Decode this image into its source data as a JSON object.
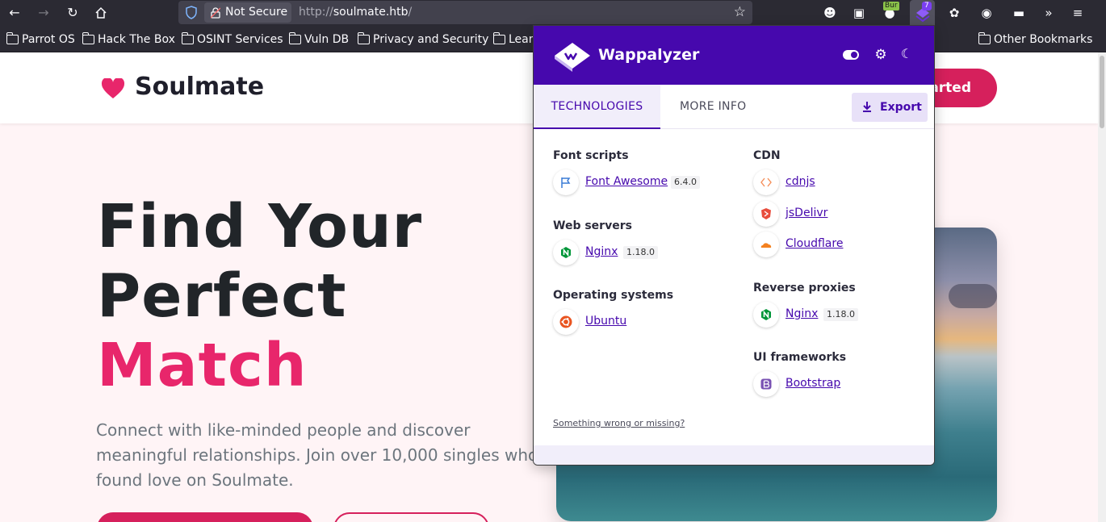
{
  "browser": {
    "security_label": "Not Secure",
    "url_scheme": "http://",
    "url_host": "soulmate.htb",
    "url_path": "/",
    "extension_badge_burp": "Bur",
    "extension_badge_wappalyzer": "7",
    "bookmarks": [
      {
        "label": "Parrot OS"
      },
      {
        "label": "Hack The Box"
      },
      {
        "label": "OSINT Services"
      },
      {
        "label": "Vuln DB"
      },
      {
        "label": "Privacy and Security"
      },
      {
        "label": "Lear"
      }
    ],
    "other_bookmarks": "Other Bookmarks"
  },
  "site": {
    "brand": "Soulmate",
    "cta_button": "arted",
    "hero_line1": "Find Your",
    "hero_line2": "Perfect",
    "hero_line3": "Match",
    "hero_subtitle": "Connect with like-minded people and discover meaningful relationships. Join over 10,000 singles who found love on Soulmate.",
    "accent_color": "#e8266b"
  },
  "wappalyzer": {
    "title": "Wappalyzer",
    "tabs": {
      "technologies": "TECHNOLOGIES",
      "more_info": "MORE INFO"
    },
    "export_label": "Export",
    "categories": {
      "font_scripts": {
        "name": "Font scripts",
        "items": [
          {
            "name": "Font Awesome",
            "version": "6.4.0",
            "icon": "flag-icon"
          }
        ]
      },
      "web_servers": {
        "name": "Web servers",
        "items": [
          {
            "name": "Nginx",
            "version": "1.18.0",
            "icon": "nginx-icon"
          }
        ]
      },
      "operating_systems": {
        "name": "Operating systems",
        "items": [
          {
            "name": "Ubuntu",
            "icon": "ubuntu-icon"
          }
        ]
      },
      "cdn": {
        "name": "CDN",
        "items": [
          {
            "name": "cdnjs",
            "icon": "cdnjs-icon"
          },
          {
            "name": "jsDelivr",
            "icon": "jsdelivr-icon"
          },
          {
            "name": "Cloudflare",
            "icon": "cloudflare-icon"
          }
        ]
      },
      "reverse_proxies": {
        "name": "Reverse proxies",
        "items": [
          {
            "name": "Nginx",
            "version": "1.18.0",
            "icon": "nginx-icon"
          }
        ]
      },
      "ui_frameworks": {
        "name": "UI frameworks",
        "items": [
          {
            "name": "Bootstrap",
            "icon": "bootstrap-icon"
          }
        ]
      }
    },
    "feedback_link": "Something wrong or missing?",
    "brand_color": "#4608ad"
  }
}
